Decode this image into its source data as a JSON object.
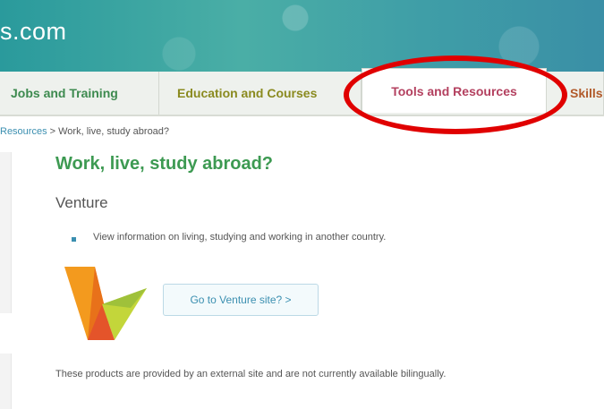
{
  "header": {
    "site_name": "s.com"
  },
  "tabs": [
    {
      "label": "Jobs and Training"
    },
    {
      "label": "Education and Courses"
    },
    {
      "label": "Tools and Resources"
    },
    {
      "label": "Skills"
    }
  ],
  "breadcrumb": {
    "link": "Resources",
    "separator": " > ",
    "current": "Work, live, study abroad?"
  },
  "main": {
    "title": "Work, live, study abroad?",
    "section": "Venture",
    "bullet": "View information on living, studying and working in another country.",
    "button": "Go to Venture site? >",
    "disclaimer": "These products are provided by an external site and are not currently available bilingually."
  },
  "colors": {
    "accent_green": "#3d9a52",
    "tab_active": "#b3405f",
    "link_blue": "#3b8fb0",
    "highlight_red": "#e00000"
  }
}
